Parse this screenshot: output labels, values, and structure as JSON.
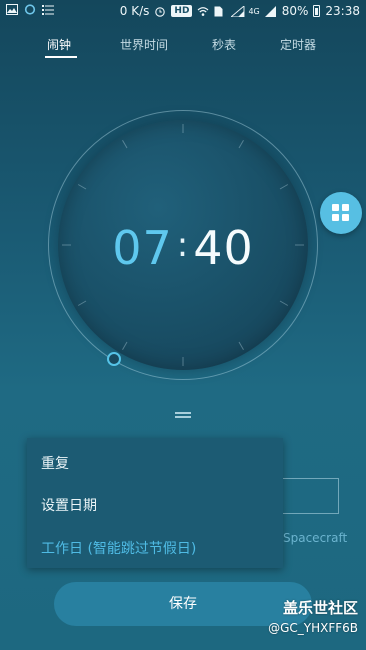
{
  "status_bar": {
    "speed": "0 K/s",
    "hd_label": "HD",
    "network": "4G",
    "battery": "80%",
    "time": "23:38",
    "icons": [
      "image-icon",
      "circle-icon",
      "list-icon",
      "alarm-clock-icon",
      "wifi-icon",
      "sim-icon",
      "signal-icon",
      "battery-icon"
    ]
  },
  "tabs": [
    {
      "label": "闹钟",
      "active": true
    },
    {
      "label": "世界时间",
      "active": false
    },
    {
      "label": "秒表",
      "active": false
    },
    {
      "label": "定时器",
      "active": false
    }
  ],
  "alarm": {
    "hour": "07",
    "colon": ":",
    "minute": "40"
  },
  "menu": {
    "items": [
      {
        "label": "重复"
      },
      {
        "label": "设置日期"
      },
      {
        "label": "工作日 (智能跳过节假日)",
        "highlight": true
      }
    ]
  },
  "background_text": {
    "link": "Spacecraft"
  },
  "save_label": "保存",
  "watermark": {
    "title": "盖乐世社区",
    "handle": "@GC_YHXFF6B"
  },
  "colors": {
    "accent": "#57bfe3",
    "background": "#1a5a73",
    "menu_bg": "#1c5b73",
    "highlight_text": "#4fbbe4"
  }
}
